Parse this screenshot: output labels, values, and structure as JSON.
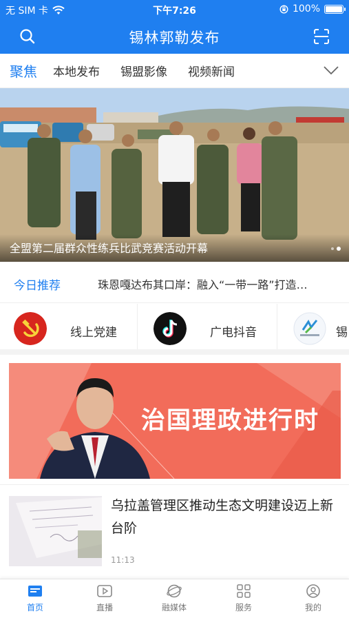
{
  "status_bar": {
    "carrier": "无 SIM 卡",
    "time": "下午7:26",
    "battery": "100%",
    "battery_level": 1.0
  },
  "header": {
    "title": "锡林郭勒发布"
  },
  "tabs": [
    {
      "label": "聚焦",
      "active": true
    },
    {
      "label": "本地发布",
      "active": false
    },
    {
      "label": "锡盟影像",
      "active": false
    },
    {
      "label": "视频新闻",
      "active": false
    }
  ],
  "banner": {
    "caption": "全盟第二届群众性练兵比武竞赛活动开幕",
    "page_count": 2,
    "current_page": 2
  },
  "recommend": {
    "label": "今日推荐",
    "headline": "珠恩嘎达布其口岸：融入“一带一路”打造…"
  },
  "shortcuts": [
    {
      "name": "线上党建",
      "icon": "party-emblem-icon"
    },
    {
      "name": "广电抖音",
      "icon": "tiktok-icon"
    },
    {
      "name": "锡",
      "icon": "xilin-media-logo-icon"
    }
  ],
  "feature": {
    "headline": "治国理政进行时"
  },
  "news": [
    {
      "title": "乌拉盖管理区推动生态文明建设迈上新台阶",
      "time": "11:13"
    }
  ],
  "tabbar": [
    {
      "label": "首页",
      "icon": "home-icon",
      "active": true
    },
    {
      "label": "直播",
      "icon": "live-play-icon",
      "active": false
    },
    {
      "label": "融媒体",
      "icon": "media-globe-icon",
      "active": false
    },
    {
      "label": "服务",
      "icon": "services-grid-icon",
      "active": false
    },
    {
      "label": "我的",
      "icon": "profile-icon",
      "active": false
    }
  ],
  "colors": {
    "brand_blue": "#1f7ff0",
    "feature_red": "#f26c5a",
    "party_red": "#d7261e"
  }
}
